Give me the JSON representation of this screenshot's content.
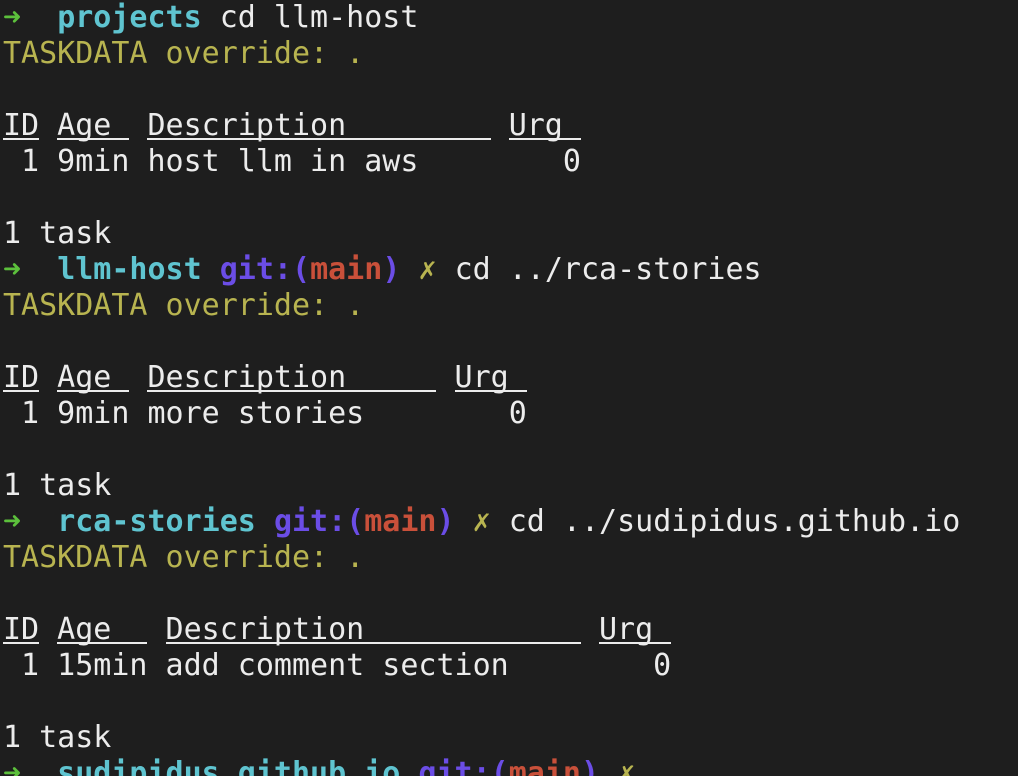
{
  "prompt_arrow": "➜",
  "dirty_mark": "✗",
  "git_label": "git:(",
  "git_close": ")",
  "sessions": [
    {
      "dir": "projects",
      "branch": null,
      "command": "cd llm-host",
      "override": "TASKDATA override: .",
      "headers": [
        "ID",
        "Age",
        "Description",
        "Urg"
      ],
      "row": {
        "id": "1",
        "age": "9min",
        "description": "host llm in aws",
        "urg": "0"
      },
      "footer": "1 task"
    },
    {
      "dir": "llm-host",
      "branch": "main",
      "command": "cd ../rca-stories",
      "override": "TASKDATA override: .",
      "headers": [
        "ID",
        "Age",
        "Description",
        "Urg"
      ],
      "row": {
        "id": "1",
        "age": "9min",
        "description": "more stories",
        "urg": "0"
      },
      "footer": "1 task"
    },
    {
      "dir": "rca-stories",
      "branch": "main",
      "command": "cd ../sudipidus.github.io",
      "override": "TASKDATA override: .",
      "headers": [
        "ID",
        "Age",
        "Description",
        "Urg"
      ],
      "row": {
        "id": "1",
        "age": "15min",
        "description": "add comment section",
        "urg": "0"
      },
      "footer": "1 task"
    }
  ],
  "last_prompt": {
    "dir": "sudipidus.github.io",
    "branch": "main"
  }
}
